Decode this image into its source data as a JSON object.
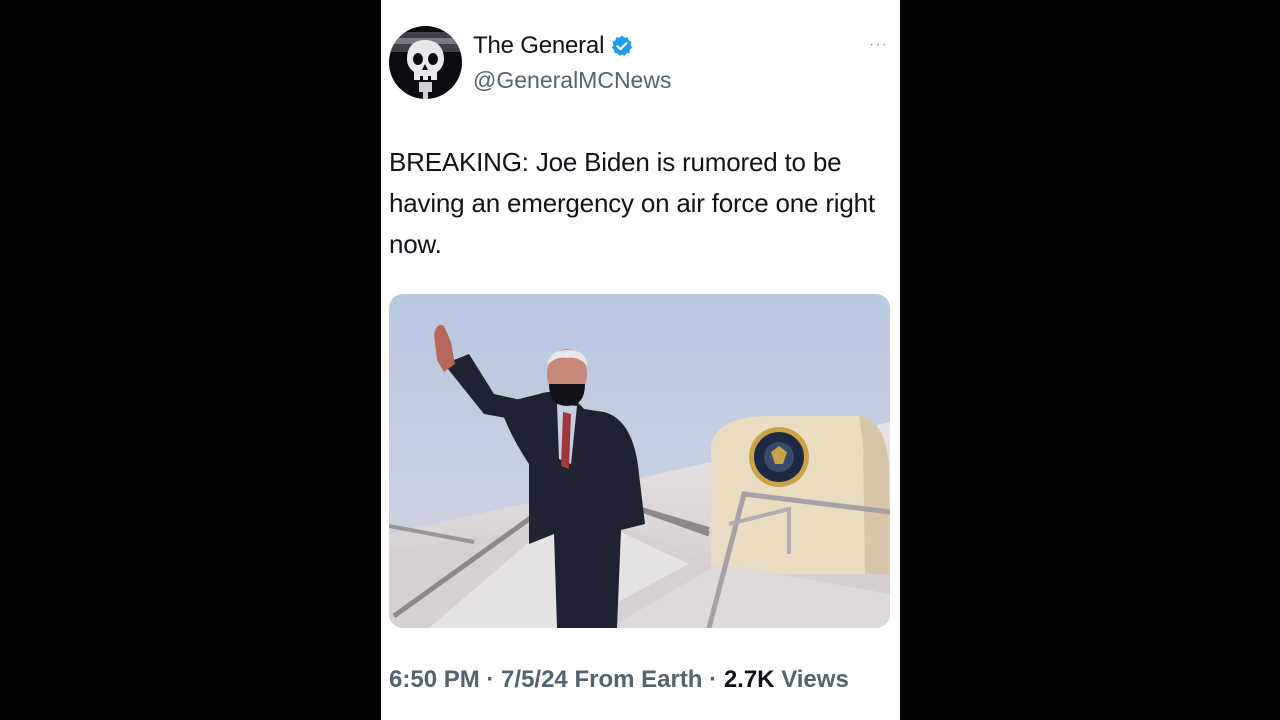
{
  "author": {
    "display_name": "The General",
    "handle": "@GeneralMCNews",
    "verified_color": "#1d9bf0"
  },
  "tweet": {
    "text": "BREAKING: Joe Biden is rumored to be having an emergency on air force one right now.",
    "media_description_icon": "photo-icon"
  },
  "meta": {
    "time": "6:50 PM",
    "separator": "·",
    "date": "7/5/24",
    "source": "From Earth",
    "views_count": "2.7K",
    "views_label": "Views"
  },
  "more_label": "···",
  "colors": {
    "background": "#000000",
    "card": "#ffffff",
    "text_primary": "#0f1419",
    "text_secondary": "#536471",
    "accent": "#1d9bf0"
  }
}
